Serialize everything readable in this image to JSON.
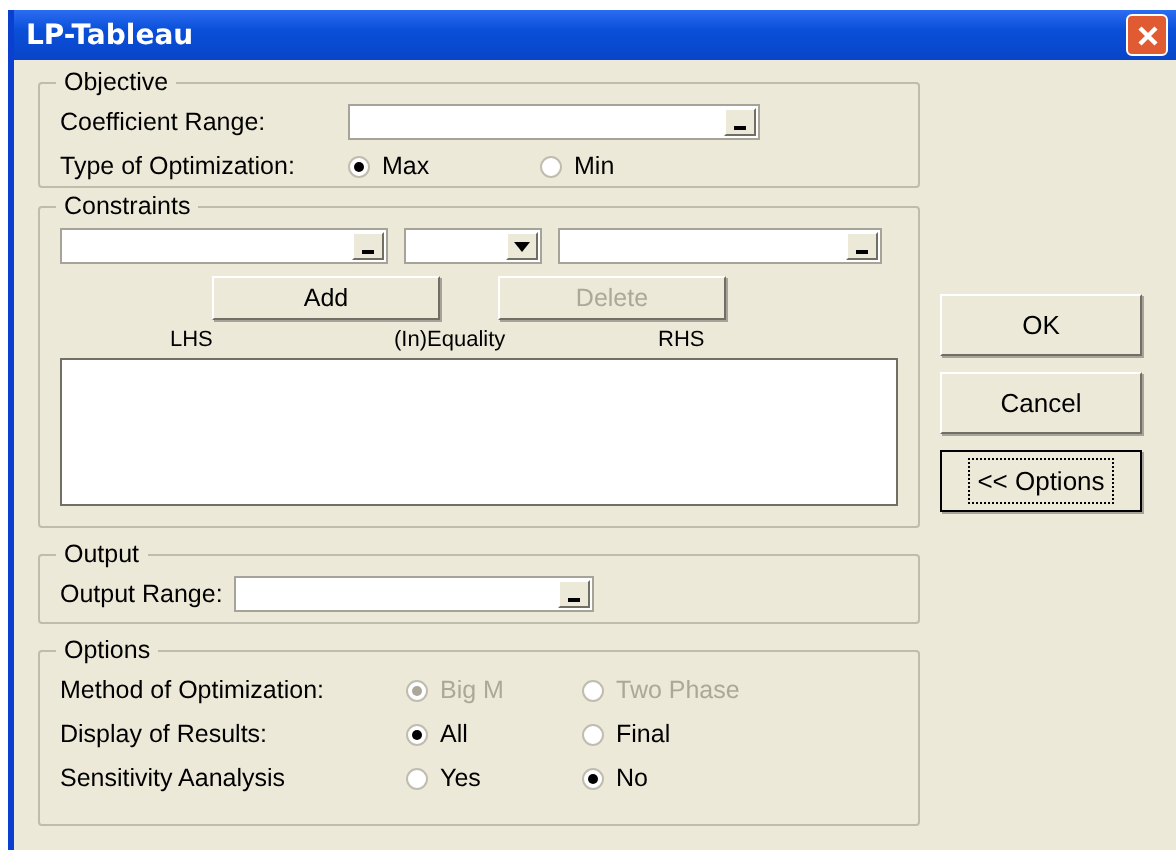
{
  "window": {
    "title": "LP-Tableau"
  },
  "objective": {
    "title": "Objective",
    "coefficient_label": "Coefficient Range:",
    "type_label": "Type of Optimization:",
    "type_options": [
      {
        "label": "Max",
        "selected": true
      },
      {
        "label": "Min",
        "selected": false
      }
    ]
  },
  "constraints": {
    "title": "Constraints",
    "add_button": {
      "label": "Add",
      "disabled": false
    },
    "delete_button": {
      "label": "Delete",
      "disabled": true
    },
    "columns": [
      "LHS",
      "(In)Equality",
      "RHS"
    ]
  },
  "output": {
    "title": "Output",
    "range_label": "Output Range:"
  },
  "options": {
    "title": "Options",
    "rows": [
      {
        "label": "Method of Optimization:",
        "disabled": true,
        "choices": [
          {
            "label": "Big M",
            "selected": true
          },
          {
            "label": "Two Phase",
            "selected": false
          }
        ]
      },
      {
        "label": "Display of Results:",
        "disabled": false,
        "choices": [
          {
            "label": "All",
            "selected": true
          },
          {
            "label": "Final",
            "selected": false
          }
        ]
      },
      {
        "label": "Sensitivity Aanalysis",
        "disabled": false,
        "choices": [
          {
            "label": "Yes",
            "selected": false
          },
          {
            "label": "No",
            "selected": true
          }
        ]
      }
    ]
  },
  "buttons": [
    {
      "label": "OK",
      "focused": false
    },
    {
      "label": "Cancel",
      "focused": false
    },
    {
      "label": "<< Options",
      "focused": true
    }
  ]
}
